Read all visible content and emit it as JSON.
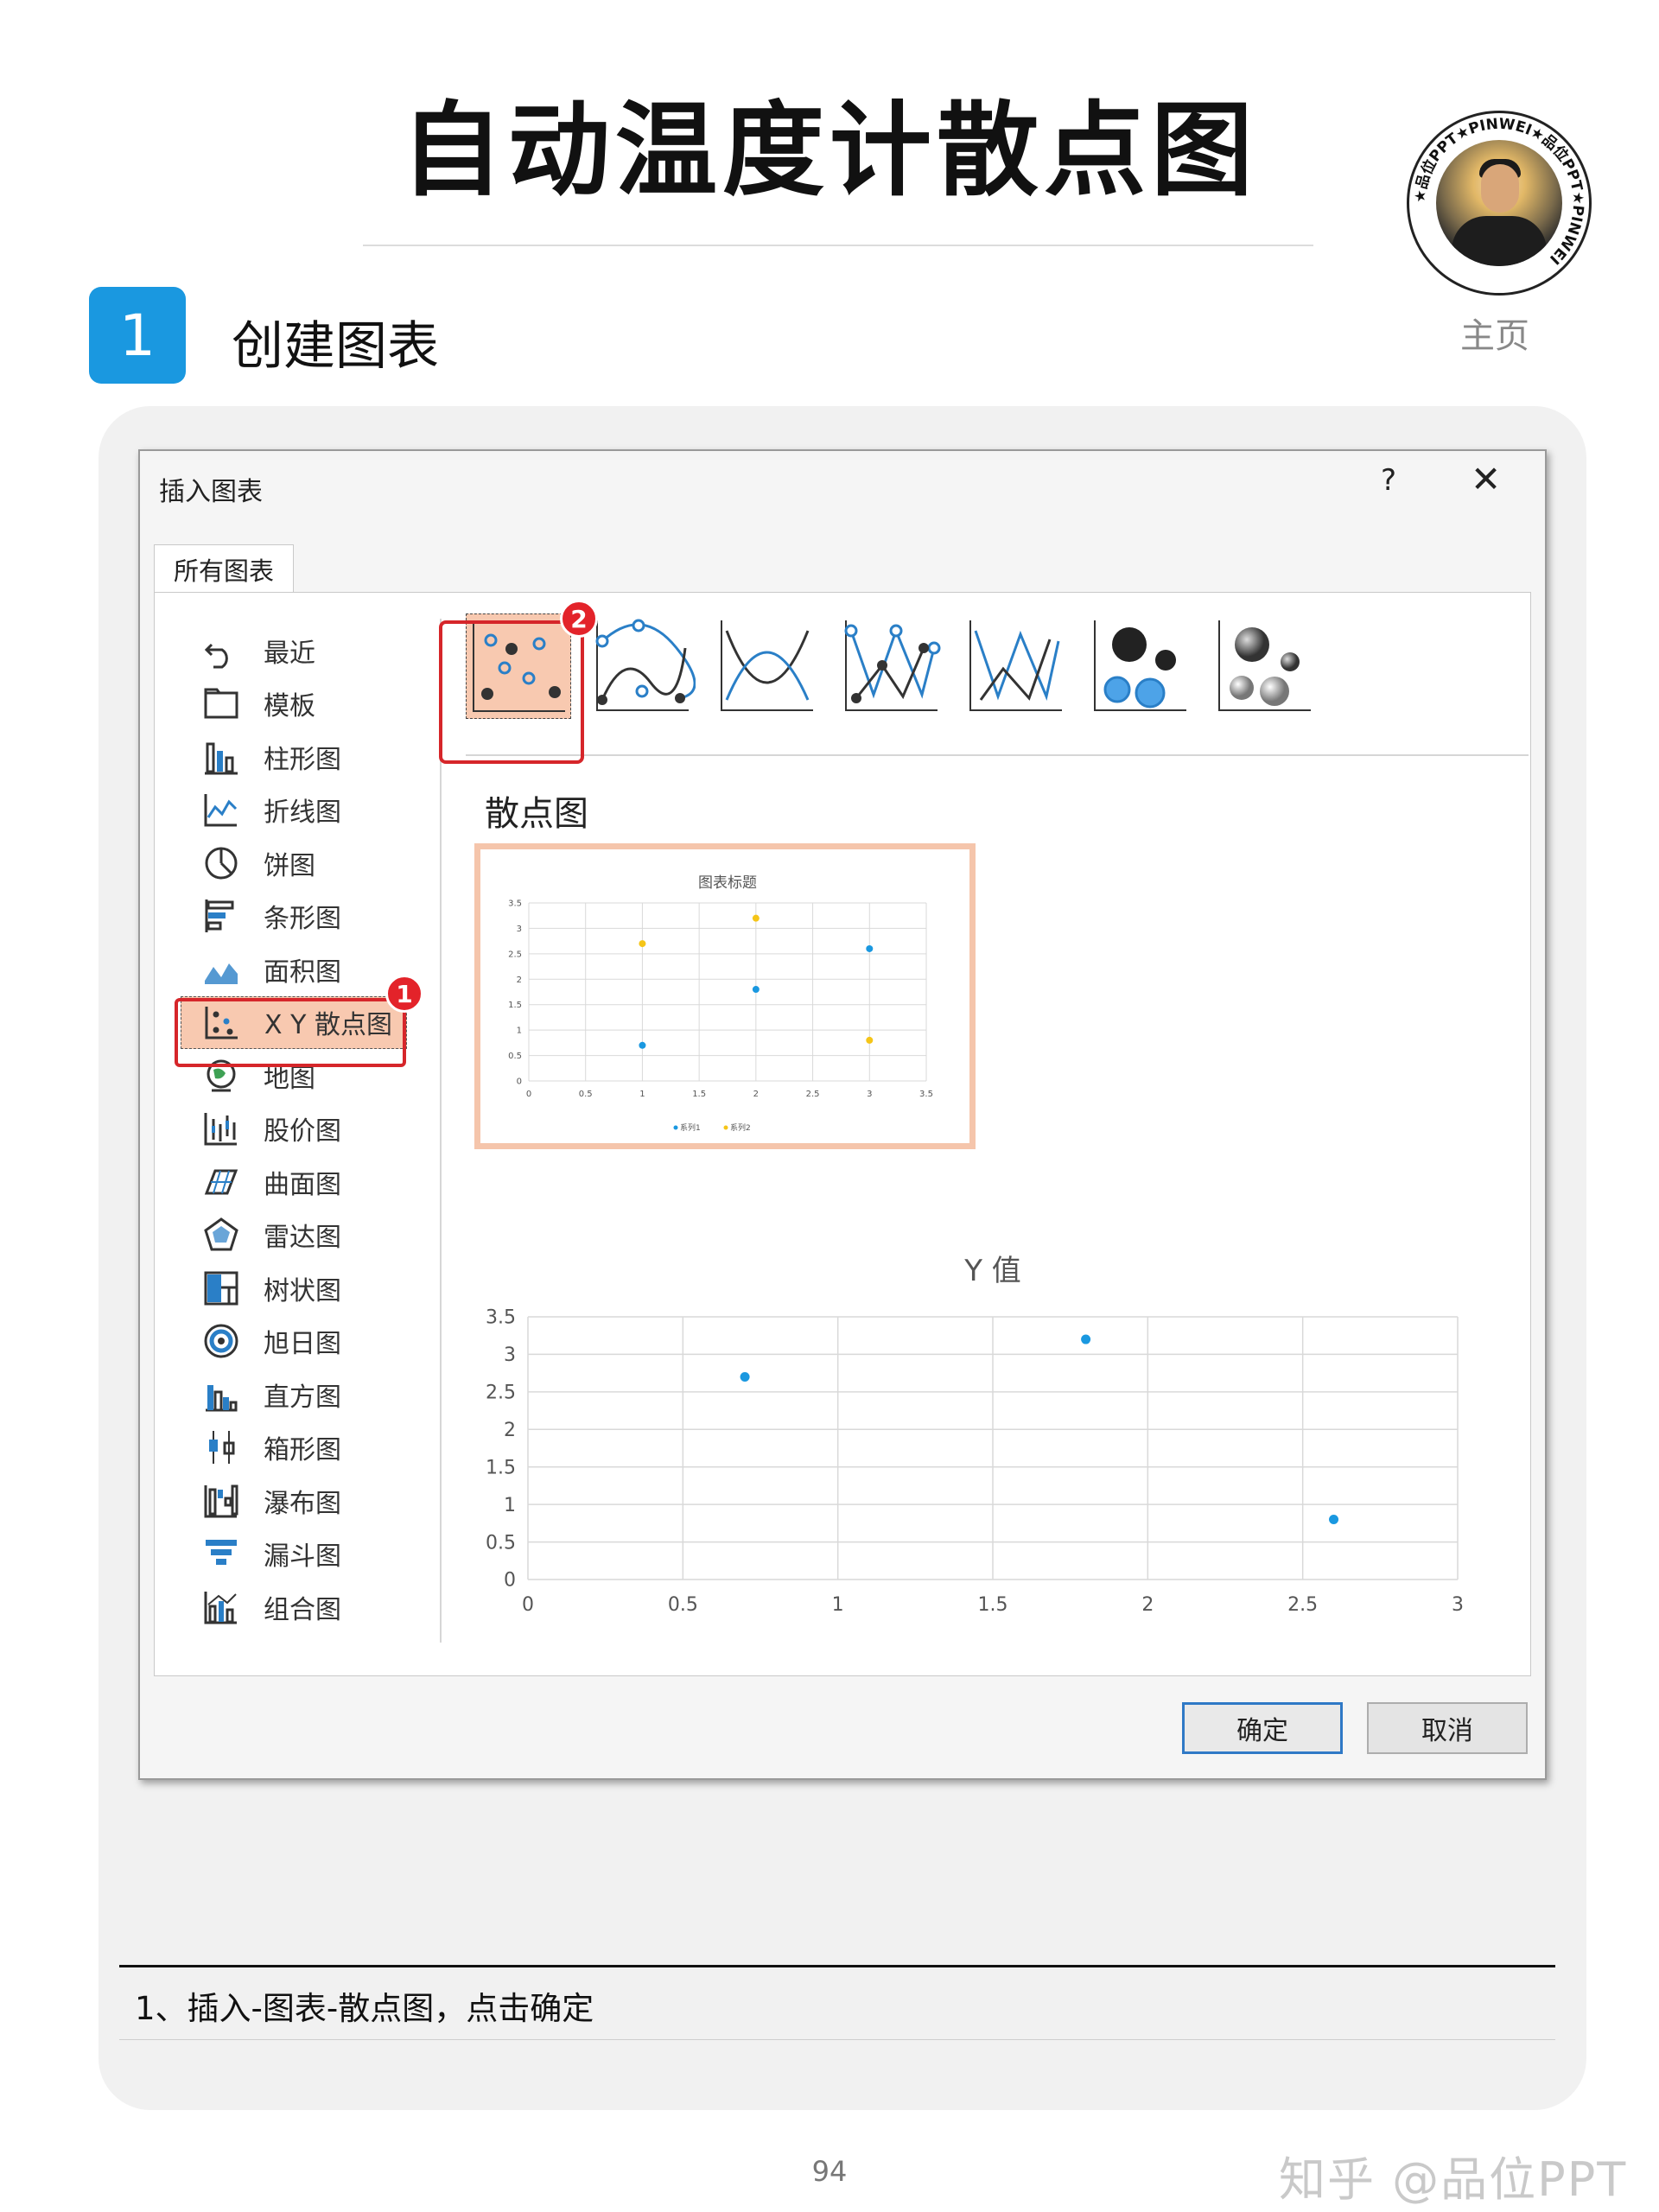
{
  "page": {
    "title": "自动温度计散点图",
    "homepage_label": "主页",
    "avatar_ring_text": "★品位PPT★PINWEI★品位PPT★PINWEI",
    "page_number": "94",
    "watermark": "知乎 @品位PPT"
  },
  "step": {
    "number": "1",
    "title": "创建图表"
  },
  "dialog": {
    "title": "插入图表",
    "help": "?",
    "close": "✕",
    "tab_label": "所有图表",
    "sidebar": [
      {
        "label": "最近",
        "icon": "undo-icon"
      },
      {
        "label": "模板",
        "icon": "folder-icon"
      },
      {
        "label": "柱形图",
        "icon": "column-chart-icon"
      },
      {
        "label": "折线图",
        "icon": "line-chart-icon"
      },
      {
        "label": "饼图",
        "icon": "pie-chart-icon"
      },
      {
        "label": "条形图",
        "icon": "bar-chart-icon"
      },
      {
        "label": "面积图",
        "icon": "area-chart-icon"
      },
      {
        "label": "X Y 散点图",
        "icon": "scatter-chart-icon",
        "selected": true
      },
      {
        "label": "地图",
        "icon": "globe-icon"
      },
      {
        "label": "股价图",
        "icon": "stock-chart-icon"
      },
      {
        "label": "曲面图",
        "icon": "surface-chart-icon"
      },
      {
        "label": "雷达图",
        "icon": "radar-chart-icon"
      },
      {
        "label": "树状图",
        "icon": "treemap-icon"
      },
      {
        "label": "旭日图",
        "icon": "sunburst-icon"
      },
      {
        "label": "直方图",
        "icon": "histogram-icon"
      },
      {
        "label": "箱形图",
        "icon": "box-whisker-icon"
      },
      {
        "label": "瀑布图",
        "icon": "waterfall-icon"
      },
      {
        "label": "漏斗图",
        "icon": "funnel-icon"
      },
      {
        "label": "组合图",
        "icon": "combo-chart-icon"
      }
    ],
    "subtype_icons": [
      "scatter-subtype-icon",
      "smooth-lines-markers-subtype-icon",
      "smooth-lines-subtype-icon",
      "straight-lines-markers-subtype-icon",
      "straight-lines-subtype-icon",
      "bubble-subtype-icon",
      "3d-bubble-subtype-icon"
    ],
    "markers": {
      "sidebar": "1",
      "subtype": "2"
    },
    "preview_title": "散点图",
    "ok_label": "确定",
    "cancel_label": "取消",
    "accent_color": "#f8c9b0",
    "marker_color": "#e3232a"
  },
  "caption": "1、插入-图表-散点图，点击确定",
  "chart_data": [
    {
      "type": "scatter",
      "title": "图表标题",
      "x_ticks": [
        "0",
        "0.5",
        "1",
        "1.5",
        "2",
        "2.5",
        "3",
        "3.5"
      ],
      "y_ticks": [
        "0",
        "0.5",
        "1",
        "1.5",
        "2",
        "2.5",
        "3",
        "3.5"
      ],
      "xlim": [
        0,
        3.5
      ],
      "ylim": [
        0,
        3.5
      ],
      "grid": true,
      "legend": "bottom",
      "series": [
        {
          "name": "系列1",
          "color": "#1a98e0",
          "points": [
            [
              1,
              0.7
            ],
            [
              2,
              1.8
            ],
            [
              3,
              2.6
            ]
          ]
        },
        {
          "name": "系列2",
          "color": "#f5c518",
          "points": [
            [
              1,
              2.7
            ],
            [
              2,
              3.2
            ],
            [
              3,
              0.8
            ]
          ]
        }
      ]
    },
    {
      "type": "scatter",
      "title": "Y 值",
      "x_ticks": [
        "0",
        "0.5",
        "1",
        "1.5",
        "2",
        "2.5",
        "3"
      ],
      "y_ticks": [
        "0",
        "0.5",
        "1",
        "1.5",
        "2",
        "2.5",
        "3",
        "3.5"
      ],
      "xlim": [
        0,
        3
      ],
      "ylim": [
        0,
        3.5
      ],
      "grid": true,
      "series": [
        {
          "color": "#1a98e0",
          "points": [
            [
              0.7,
              2.7
            ],
            [
              1.8,
              3.2
            ],
            [
              2.6,
              0.8
            ]
          ]
        }
      ]
    }
  ]
}
